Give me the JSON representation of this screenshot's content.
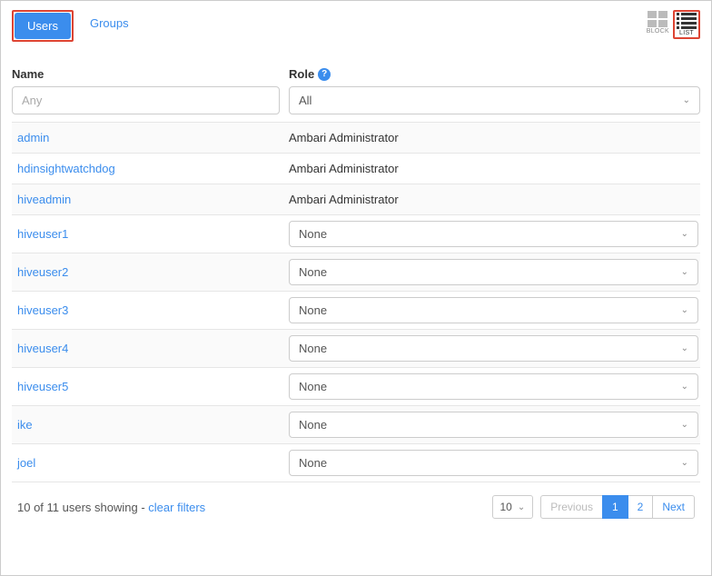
{
  "tabs": {
    "users": "Users",
    "groups": "Groups",
    "active": "users"
  },
  "view_toggle": {
    "block": "BLOCK",
    "list": "LIST",
    "active": "list"
  },
  "columns": {
    "name": "Name",
    "role": "Role"
  },
  "filters": {
    "name_placeholder": "Any",
    "role_selected": "All"
  },
  "rows": [
    {
      "name": "admin",
      "role_text": "Ambari Administrator",
      "editable": false
    },
    {
      "name": "hdinsightwatchdog",
      "role_text": "Ambari Administrator",
      "editable": false
    },
    {
      "name": "hiveadmin",
      "role_text": "Ambari Administrator",
      "editable": false
    },
    {
      "name": "hiveuser1",
      "role_text": "None",
      "editable": true
    },
    {
      "name": "hiveuser2",
      "role_text": "None",
      "editable": true
    },
    {
      "name": "hiveuser3",
      "role_text": "None",
      "editable": true
    },
    {
      "name": "hiveuser4",
      "role_text": "None",
      "editable": true
    },
    {
      "name": "hiveuser5",
      "role_text": "None",
      "editable": true
    },
    {
      "name": "ike",
      "role_text": "None",
      "editable": true
    },
    {
      "name": "joel",
      "role_text": "None",
      "editable": true
    }
  ],
  "footer": {
    "showing_prefix": "10 of 11 users showing - ",
    "clear_filters": "clear filters",
    "page_size": "10",
    "previous": "Previous",
    "next": "Next",
    "pages": [
      "1",
      "2"
    ],
    "active_page": "1"
  }
}
